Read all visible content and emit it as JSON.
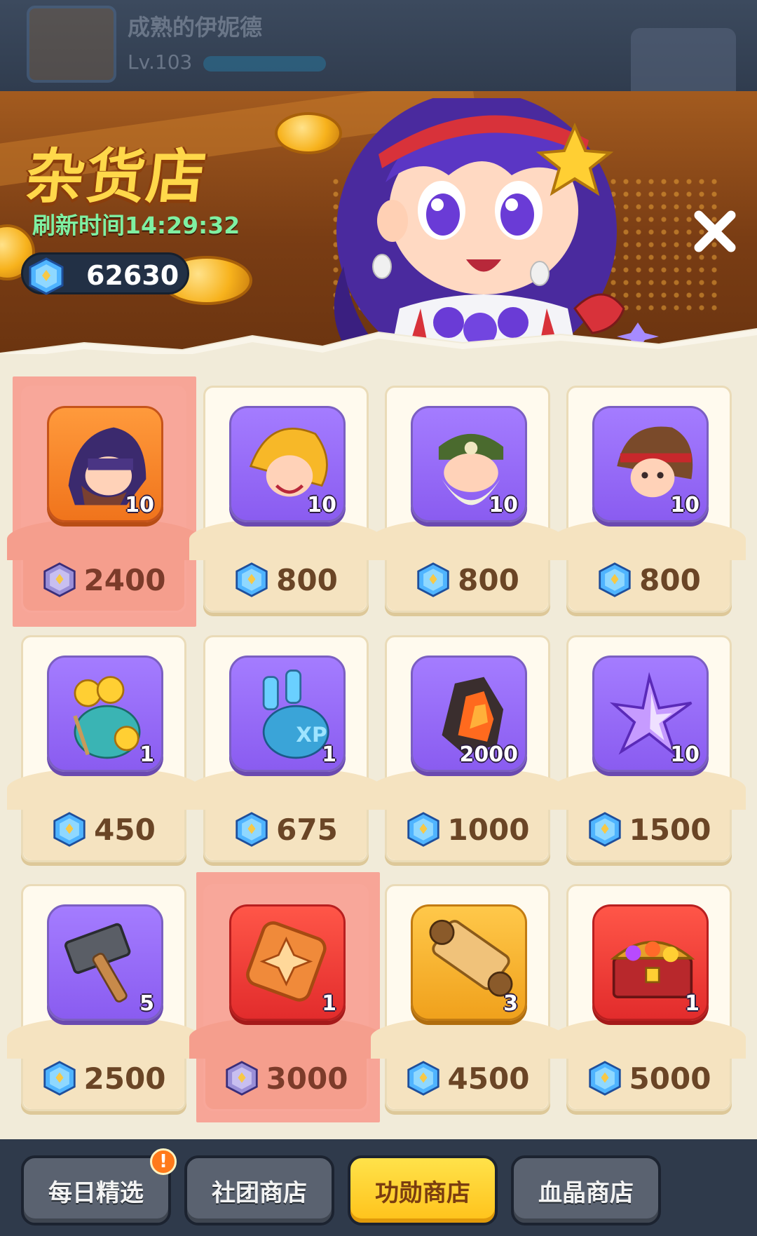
{
  "player": {
    "name": "成熟的伊妮德",
    "level": "Lv.103"
  },
  "shop": {
    "title": "杂货店",
    "refresh_label": "刷新时间",
    "refresh_time": "14:29:32",
    "currency_amount": "62630",
    "close_icon": "close-icon"
  },
  "items": [
    {
      "icon": "athena-fragment-icon",
      "qty": "10",
      "price": "2400",
      "frame": "orange",
      "highlight": true
    },
    {
      "icon": "blonde-hero-fragment-icon",
      "qty": "10",
      "price": "800",
      "frame": "purple",
      "highlight": false
    },
    {
      "icon": "old-master-fragment-icon",
      "qty": "10",
      "price": "800",
      "frame": "purple",
      "highlight": false
    },
    {
      "icon": "headband-hero-fragment-icon",
      "qty": "10",
      "price": "800",
      "frame": "purple",
      "highlight": false
    },
    {
      "icon": "gold-coin-bag-icon",
      "qty": "1",
      "price": "450",
      "frame": "purple",
      "highlight": false
    },
    {
      "icon": "exp-potion-bag-icon",
      "qty": "1",
      "price": "675",
      "frame": "purple",
      "highlight": false
    },
    {
      "icon": "fire-ore-icon",
      "qty": "2000",
      "price": "1000",
      "frame": "purple",
      "highlight": false
    },
    {
      "icon": "purple-star-icon",
      "qty": "10",
      "price": "1500",
      "frame": "purple",
      "highlight": false
    },
    {
      "icon": "hammer-icon",
      "qty": "5",
      "price": "2500",
      "frame": "purple",
      "highlight": false
    },
    {
      "icon": "rune-tile-icon",
      "qty": "1",
      "price": "3000",
      "frame": "red",
      "highlight": true
    },
    {
      "icon": "scroll-icon",
      "qty": "3",
      "price": "4500",
      "frame": "gold",
      "highlight": false
    },
    {
      "icon": "treasure-chest-icon",
      "qty": "1",
      "price": "5000",
      "frame": "red",
      "highlight": false
    }
  ],
  "tabs": [
    {
      "label": "每日精选",
      "active": false,
      "badge": "!"
    },
    {
      "label": "社团商店",
      "active": false
    },
    {
      "label": "功勋商店",
      "active": true
    },
    {
      "label": "血晶商店",
      "active": false
    }
  ],
  "colors": {
    "active_tab": "#ffc21a",
    "highlight": "#f7a597",
    "price_text": "#6a4526",
    "refresh_text": "#7ff0a2",
    "title_text": "#ffd84a"
  }
}
